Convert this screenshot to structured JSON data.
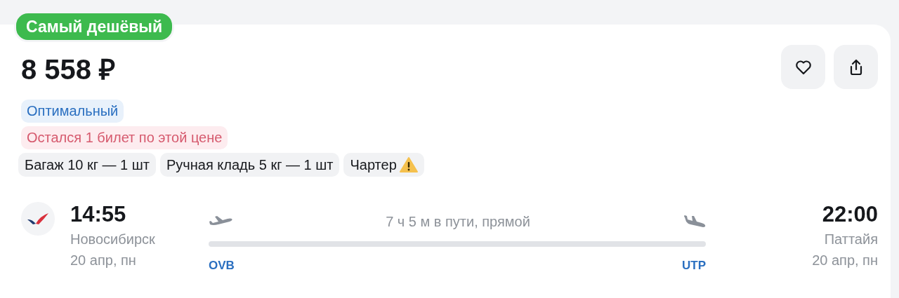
{
  "badge": "Самый дешёвый",
  "price": "8 558 ₽",
  "labels": [
    {
      "kind": "info",
      "text": "Оптимальный"
    },
    {
      "kind": "alert",
      "text": "Остался 1 билет по этой цене"
    }
  ],
  "features": [
    {
      "text": "Багаж 10 кг — 1 шт",
      "warning": false
    },
    {
      "text": "Ручная кладь 5 кг — 1 шт",
      "warning": false
    },
    {
      "text": "Чартер",
      "warning": true
    }
  ],
  "flight": {
    "departure": {
      "time": "14:55",
      "city": "Новосибирск",
      "date": "20 апр, пн",
      "code": "OVB"
    },
    "duration": "7 ч 5 м в пути, прямой",
    "arrival": {
      "time": "22:00",
      "city": "Паттайя",
      "date": "20 апр, пн",
      "code": "UTP"
    }
  }
}
